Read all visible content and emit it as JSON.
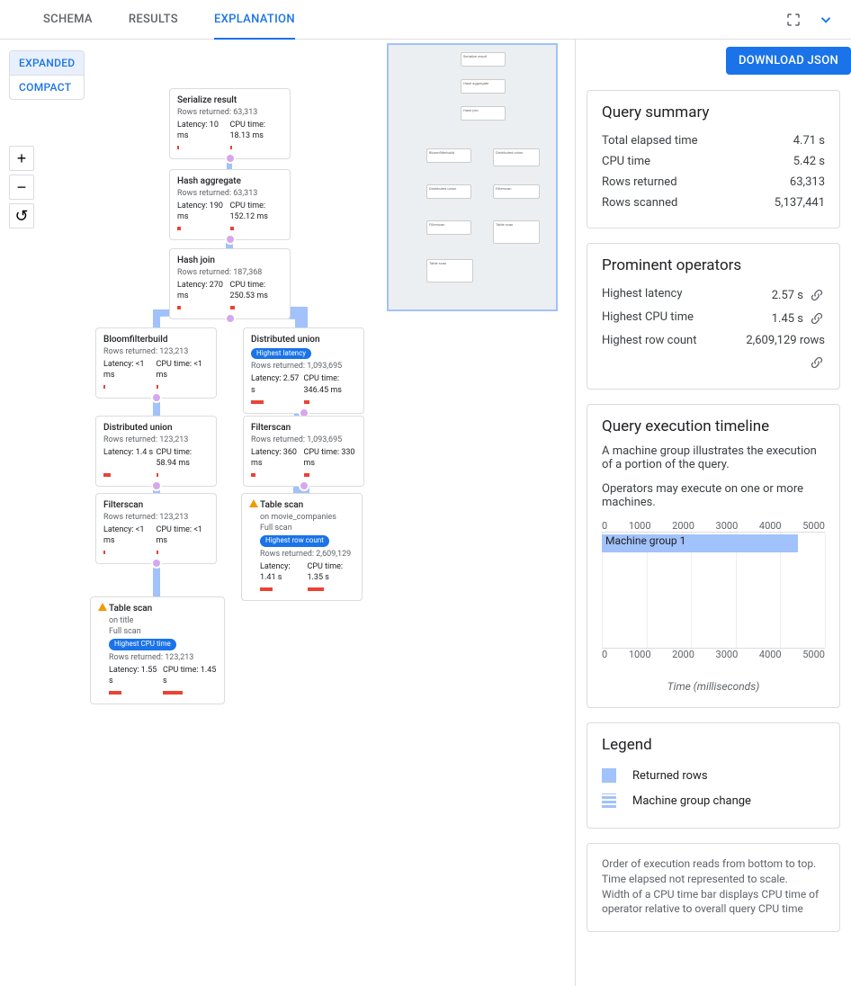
{
  "tabs": {
    "schema": "SCHEMA",
    "results": "RESULTS",
    "explanation": "EXPLANATION"
  },
  "download_btn": "DOWNLOAD JSON",
  "view_toggle": {
    "expanded": "EXPANDED",
    "compact": "COMPACT"
  },
  "zoom": {
    "in": "+",
    "out": "−",
    "reset": "↺"
  },
  "summary": {
    "title": "Query summary",
    "rows": [
      {
        "k": "Total elapsed time",
        "v": "4.71 s"
      },
      {
        "k": "CPU time",
        "v": "5.42 s"
      },
      {
        "k": "Rows returned",
        "v": "63,313"
      },
      {
        "k": "Rows scanned",
        "v": "5,137,441"
      }
    ]
  },
  "prominent": {
    "title": "Prominent operators",
    "rows": [
      {
        "k": "Highest latency",
        "v": "2.57 s"
      },
      {
        "k": "Highest CPU time",
        "v": "1.45 s"
      },
      {
        "k": "Highest row count",
        "v": "2,609,129 rows"
      }
    ]
  },
  "timeline": {
    "title": "Query execution timeline",
    "desc1": "A machine group illustrates the execution of a portion of the query.",
    "desc2": "Operators may execute on one or more machines.",
    "ticks": [
      "0",
      "1000",
      "2000",
      "3000",
      "4000",
      "5000"
    ],
    "bar_label": "Machine group 1",
    "xlabel": "Time (milliseconds)"
  },
  "legend": {
    "title": "Legend",
    "returned": "Returned rows",
    "mgchange": "Machine group change"
  },
  "footnote": {
    "l1": "Order of execution reads from bottom to top.",
    "l2": "Time elapsed not represented to scale.",
    "l3": "Width of a CPU time bar displays CPU time of operator relative to overall query CPU time"
  },
  "nodes": {
    "serialize": {
      "title": "Serialize result",
      "rows": "Rows returned: 63,313",
      "lat": "Latency: 10 ms",
      "cpu": "CPU time: 18.13 ms"
    },
    "hashagg": {
      "title": "Hash aggregate",
      "rows": "Rows returned: 63,313",
      "lat": "Latency: 190 ms",
      "cpu": "CPU time: 152.12 ms"
    },
    "hashjoin": {
      "title": "Hash join",
      "rows": "Rows returned: 187,368",
      "lat": "Latency: 270 ms",
      "cpu": "CPU time: 250.53 ms"
    },
    "bloom": {
      "title": "Bloomfilterbuild",
      "rows": "Rows returned: 123,213",
      "lat": "Latency: <1 ms",
      "cpu": "CPU time: <1 ms"
    },
    "dunion_r": {
      "title": "Distributed union",
      "badge": "Highest latency",
      "rows": "Rows returned: 1,093,695",
      "lat": "Latency: 2.57 s",
      "cpu": "CPU time: 346.45 ms"
    },
    "dunion_l": {
      "title": "Distributed union",
      "rows": "Rows returned: 123,213",
      "lat": "Latency: 1.4 s",
      "cpu": "CPU time: 58.94 ms"
    },
    "filter_r": {
      "title": "Filterscan",
      "rows": "Rows returned: 1,093,695",
      "lat": "Latency: 360 ms",
      "cpu": "CPU time: 330 ms"
    },
    "filter_l": {
      "title": "Filterscan",
      "rows": "Rows returned: 123,213",
      "lat": "Latency: <1 ms",
      "cpu": "CPU time: <1 ms"
    },
    "tscan_r": {
      "title": "Table scan",
      "on": "on movie_companies",
      "full": "Full scan",
      "badge": "Highest row count",
      "rows": "Rows returned: 2,609,129",
      "lat": "Latency: 1.41 s",
      "cpu": "CPU time: 1.35 s"
    },
    "tscan_l": {
      "title": "Table scan",
      "on": "on title",
      "full": "Full scan",
      "badge": "Highest CPU time",
      "rows": "Rows returned: 123,213",
      "lat": "Latency: 1.55 s",
      "cpu": "CPU time: 1.45 s"
    }
  },
  "chart_data": {
    "plan_tree": {
      "type": "tree",
      "nodes": [
        {
          "id": "serialize",
          "title": "Serialize result",
          "rows_returned": 63313,
          "latency_ms": 10,
          "cpu_ms": 18.13
        },
        {
          "id": "hashagg",
          "title": "Hash aggregate",
          "rows_returned": 63313,
          "latency_ms": 190,
          "cpu_ms": 152.12
        },
        {
          "id": "hashjoin",
          "title": "Hash join",
          "rows_returned": 187368,
          "latency_ms": 270,
          "cpu_ms": 250.53
        },
        {
          "id": "bloom",
          "title": "Bloomfilterbuild",
          "rows_returned": 123213,
          "latency_ms": 0,
          "cpu_ms": 0
        },
        {
          "id": "dunion_r",
          "title": "Distributed union",
          "rows_returned": 1093695,
          "latency_ms": 2570,
          "cpu_ms": 346.45,
          "badge": "Highest latency"
        },
        {
          "id": "dunion_l",
          "title": "Distributed union",
          "rows_returned": 123213,
          "latency_ms": 1400,
          "cpu_ms": 58.94
        },
        {
          "id": "filter_r",
          "title": "Filterscan",
          "rows_returned": 1093695,
          "latency_ms": 360,
          "cpu_ms": 330
        },
        {
          "id": "filter_l",
          "title": "Filterscan",
          "rows_returned": 123213,
          "latency_ms": 0,
          "cpu_ms": 0
        },
        {
          "id": "tscan_r",
          "title": "Table scan",
          "on": "movie_companies",
          "full_scan": true,
          "rows_returned": 2609129,
          "latency_ms": 1410,
          "cpu_ms": 1350,
          "badge": "Highest row count"
        },
        {
          "id": "tscan_l",
          "title": "Table scan",
          "on": "title",
          "full_scan": true,
          "rows_returned": 123213,
          "latency_ms": 1550,
          "cpu_ms": 1450,
          "badge": "Highest CPU time"
        }
      ],
      "edges": [
        [
          "hashagg",
          "serialize"
        ],
        [
          "hashjoin",
          "hashagg"
        ],
        [
          "bloom",
          "hashjoin"
        ],
        [
          "dunion_r",
          "hashjoin"
        ],
        [
          "dunion_l",
          "bloom"
        ],
        [
          "filter_r",
          "dunion_r"
        ],
        [
          "filter_l",
          "dunion_l"
        ],
        [
          "tscan_r",
          "filter_r"
        ],
        [
          "tscan_l",
          "filter_l"
        ]
      ]
    },
    "timeline": {
      "type": "bar",
      "xlabel": "Time (milliseconds)",
      "xlim": [
        0,
        5000
      ],
      "ticks": [
        0,
        1000,
        2000,
        3000,
        4000,
        5000
      ],
      "series": [
        {
          "name": "Machine group 1",
          "start": 0,
          "end": 4710
        }
      ]
    }
  }
}
